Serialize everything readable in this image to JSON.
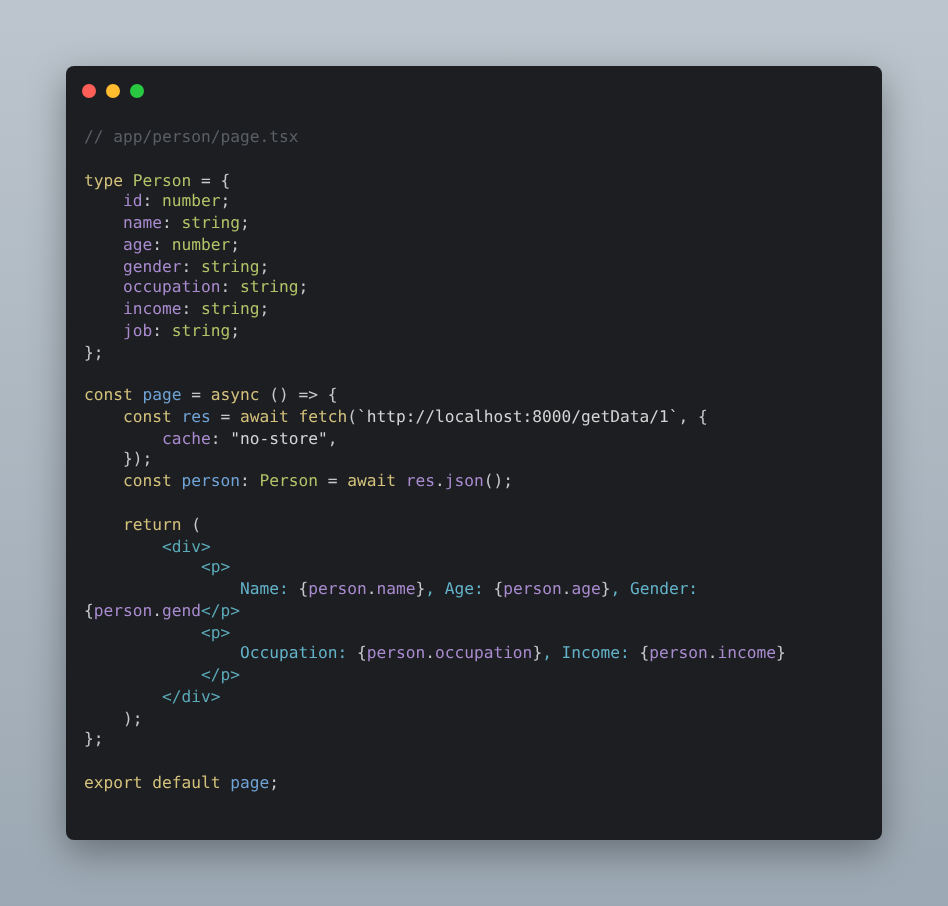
{
  "window": {
    "controls": [
      {
        "color": "#ff5f57"
      },
      {
        "color": "#febc2e"
      },
      {
        "color": "#28c840"
      }
    ]
  },
  "code": [
    {
      "kind": "code",
      "tokens": [
        {
          "text": "// app/person/page.tsx",
          "kind": "comment"
        }
      ]
    },
    {
      "kind": "blank"
    },
    {
      "kind": "code",
      "tokens": [
        {
          "text": "type ",
          "kind": "keyword"
        },
        {
          "text": "Person",
          "kind": "type"
        },
        {
          "text": " = {",
          "kind": "plain"
        }
      ]
    },
    {
      "kind": "code",
      "tokens": [
        {
          "text": "    id",
          "kind": "prop"
        },
        {
          "text": ": ",
          "kind": "plain"
        },
        {
          "text": "number",
          "kind": "type"
        },
        {
          "text": ";",
          "kind": "plain"
        }
      ]
    },
    {
      "kind": "code",
      "tokens": [
        {
          "text": "    name",
          "kind": "prop"
        },
        {
          "text": ": ",
          "kind": "plain"
        },
        {
          "text": "string",
          "kind": "type"
        },
        {
          "text": ";",
          "kind": "plain"
        }
      ]
    },
    {
      "kind": "code",
      "tokens": [
        {
          "text": "    age",
          "kind": "prop"
        },
        {
          "text": ": ",
          "kind": "plain"
        },
        {
          "text": "number",
          "kind": "type"
        },
        {
          "text": ";",
          "kind": "plain"
        }
      ]
    },
    {
      "kind": "code",
      "tokens": [
        {
          "text": "    gender",
          "kind": "prop"
        },
        {
          "text": ": ",
          "kind": "plain"
        },
        {
          "text": "string",
          "kind": "type"
        },
        {
          "text": ";",
          "kind": "plain"
        }
      ]
    },
    {
      "kind": "code",
      "tokens": [
        {
          "text": "    occupation",
          "kind": "prop"
        },
        {
          "text": ": ",
          "kind": "plain"
        },
        {
          "text": "string",
          "kind": "type"
        },
        {
          "text": ";",
          "kind": "plain"
        }
      ]
    },
    {
      "kind": "code",
      "tokens": [
        {
          "text": "    income",
          "kind": "prop"
        },
        {
          "text": ": ",
          "kind": "plain"
        },
        {
          "text": "string",
          "kind": "type"
        },
        {
          "text": ";",
          "kind": "plain"
        }
      ]
    },
    {
      "kind": "code",
      "tokens": [
        {
          "text": "    job",
          "kind": "prop"
        },
        {
          "text": ": ",
          "kind": "plain"
        },
        {
          "text": "string",
          "kind": "type"
        },
        {
          "text": ";",
          "kind": "plain"
        }
      ]
    },
    {
      "kind": "code",
      "tokens": [
        {
          "text": "};",
          "kind": "plain"
        }
      ]
    },
    {
      "kind": "blank"
    },
    {
      "kind": "code",
      "tokens": [
        {
          "text": "const ",
          "kind": "keyword"
        },
        {
          "text": "page",
          "kind": "ident"
        },
        {
          "text": " = ",
          "kind": "plain"
        },
        {
          "text": "async",
          "kind": "keyword"
        },
        {
          "text": " () => {",
          "kind": "plain"
        }
      ]
    },
    {
      "kind": "code",
      "tokens": [
        {
          "text": "    const ",
          "kind": "keyword"
        },
        {
          "text": "res",
          "kind": "ident"
        },
        {
          "text": " = ",
          "kind": "plain"
        },
        {
          "text": "await fetch",
          "kind": "keyword"
        },
        {
          "text": "(",
          "kind": "plain"
        },
        {
          "text": "`http://localhost:8000/getData/1`",
          "kind": "string"
        },
        {
          "text": ", {",
          "kind": "plain"
        }
      ]
    },
    {
      "kind": "code",
      "tokens": [
        {
          "text": "        cache",
          "kind": "prop"
        },
        {
          "text": ": ",
          "kind": "plain"
        },
        {
          "text": "\"no-store\"",
          "kind": "string"
        },
        {
          "text": ",",
          "kind": "plain"
        }
      ]
    },
    {
      "kind": "code",
      "tokens": [
        {
          "text": "    });",
          "kind": "plain"
        }
      ]
    },
    {
      "kind": "code",
      "tokens": [
        {
          "text": "    const ",
          "kind": "keyword"
        },
        {
          "text": "person",
          "kind": "ident"
        },
        {
          "text": ": ",
          "kind": "plain"
        },
        {
          "text": "Person",
          "kind": "type"
        },
        {
          "text": " = ",
          "kind": "plain"
        },
        {
          "text": "await ",
          "kind": "keyword"
        },
        {
          "text": "res",
          "kind": "prop"
        },
        {
          "text": ".",
          "kind": "plain"
        },
        {
          "text": "json",
          "kind": "prop"
        },
        {
          "text": "();",
          "kind": "plain"
        }
      ]
    },
    {
      "kind": "blank"
    },
    {
      "kind": "code",
      "tokens": [
        {
          "text": "    return",
          "kind": "keyword"
        },
        {
          "text": " (",
          "kind": "plain"
        }
      ]
    },
    {
      "kind": "code",
      "tokens": [
        {
          "text": "        <div>",
          "kind": "tag"
        }
      ]
    },
    {
      "kind": "code",
      "tokens": [
        {
          "text": "            <p>",
          "kind": "tag"
        }
      ]
    },
    {
      "kind": "code",
      "tokens": [
        {
          "text": "                Name: ",
          "kind": "jsx"
        },
        {
          "text": "{",
          "kind": "plain"
        },
        {
          "text": "person",
          "kind": "prop"
        },
        {
          "text": ".",
          "kind": "plain"
        },
        {
          "text": "name",
          "kind": "prop"
        },
        {
          "text": "}",
          "kind": "plain"
        },
        {
          "text": ", Age: ",
          "kind": "jsx"
        },
        {
          "text": "{",
          "kind": "plain"
        },
        {
          "text": "person",
          "kind": "prop"
        },
        {
          "text": ".",
          "kind": "plain"
        },
        {
          "text": "age",
          "kind": "prop"
        },
        {
          "text": "}",
          "kind": "plain"
        },
        {
          "text": ", Gender:",
          "kind": "jsx"
        }
      ]
    },
    {
      "kind": "code",
      "tokens": [
        {
          "text": "{",
          "kind": "plain"
        },
        {
          "text": "person",
          "kind": "prop"
        },
        {
          "text": ".",
          "kind": "plain"
        },
        {
          "text": "gend",
          "kind": "prop"
        },
        {
          "text": "</p>",
          "kind": "tag"
        }
      ]
    },
    {
      "kind": "code",
      "tokens": [
        {
          "text": "            <p>",
          "kind": "tag"
        }
      ]
    },
    {
      "kind": "code",
      "tokens": [
        {
          "text": "                Occupation: ",
          "kind": "jsx"
        },
        {
          "text": "{",
          "kind": "plain"
        },
        {
          "text": "person",
          "kind": "prop"
        },
        {
          "text": ".",
          "kind": "plain"
        },
        {
          "text": "occupation",
          "kind": "prop"
        },
        {
          "text": "}",
          "kind": "plain"
        },
        {
          "text": ", Income: ",
          "kind": "jsx"
        },
        {
          "text": "{",
          "kind": "plain"
        },
        {
          "text": "person",
          "kind": "prop"
        },
        {
          "text": ".",
          "kind": "plain"
        },
        {
          "text": "income",
          "kind": "prop"
        },
        {
          "text": "}",
          "kind": "plain"
        }
      ]
    },
    {
      "kind": "code",
      "tokens": [
        {
          "text": "            </p>",
          "kind": "tag"
        }
      ]
    },
    {
      "kind": "code",
      "tokens": [
        {
          "text": "        </div>",
          "kind": "tag"
        }
      ]
    },
    {
      "kind": "code",
      "tokens": [
        {
          "text": "    );",
          "kind": "plain"
        }
      ]
    },
    {
      "kind": "code",
      "tokens": [
        {
          "text": "};",
          "kind": "plain"
        }
      ]
    },
    {
      "kind": "blank"
    },
    {
      "kind": "code",
      "tokens": [
        {
          "text": "export default ",
          "kind": "keyword"
        },
        {
          "text": "page",
          "kind": "ident"
        },
        {
          "text": ";",
          "kind": "plain"
        }
      ]
    }
  ]
}
